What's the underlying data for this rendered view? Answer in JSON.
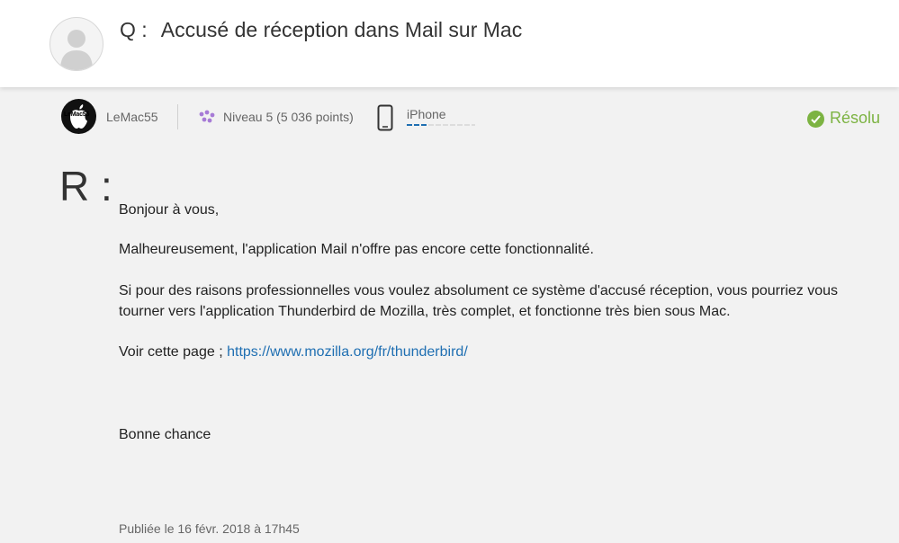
{
  "question": {
    "prefix": "Q :",
    "title": "Accusé de réception dans Mail sur Mac"
  },
  "author": {
    "avatar_text": "LeMac55",
    "name": "LeMac55",
    "level": "Niveau 5",
    "points": "(5 036 points)",
    "device": "iPhone"
  },
  "status": {
    "label": "Résolu",
    "color": "#7cb342"
  },
  "answer": {
    "prefix": "R :",
    "greeting": "Bonjour à vous,",
    "para1": "Malheureusement, l'application Mail n'offre pas encore cette fonctionnalité.",
    "para2": "Si pour des raisons professionnelles vous voulez absolument ce système d'accusé réception, vous pourriez vous tourner vers l'application Thunderbird de Mozilla, très complet, et fonctionne très bien sous Mac.",
    "link_intro": "Voir cette page ;",
    "link_text": "https://www.mozilla.org/fr/thunderbird/",
    "closing": "Bonne chance",
    "published": "Publiée le 16 févr. 2018 à 17h45"
  }
}
